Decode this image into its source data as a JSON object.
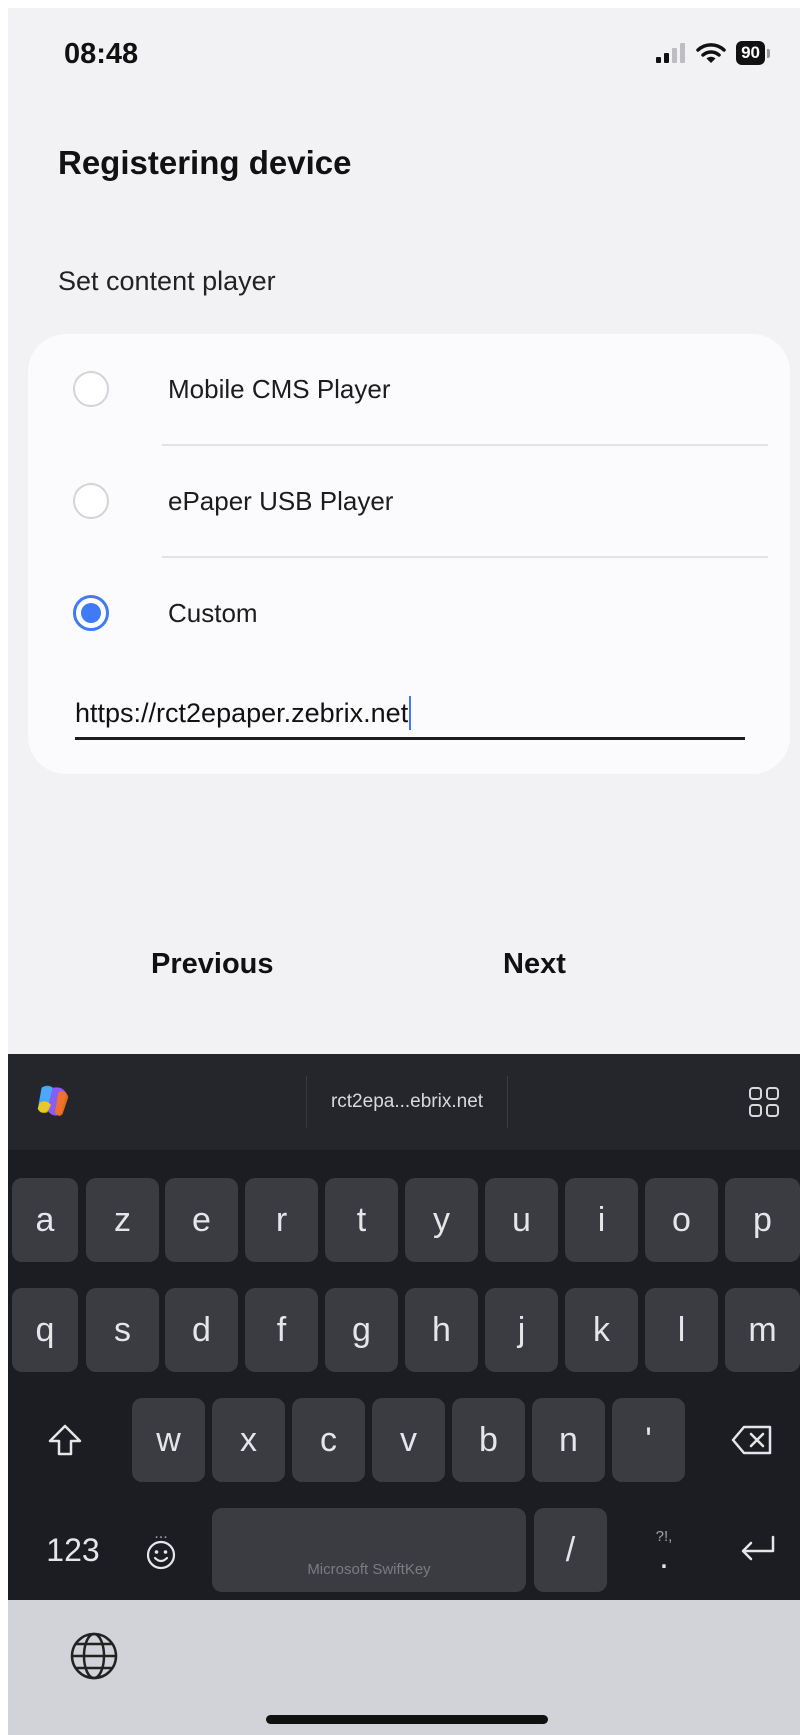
{
  "status": {
    "time": "08:48",
    "battery": "90"
  },
  "page": {
    "title": "Registering device",
    "section_label": "Set content player"
  },
  "options": [
    {
      "label": "Mobile CMS Player",
      "selected": false
    },
    {
      "label": "ePaper USB Player",
      "selected": false
    },
    {
      "label": "Custom",
      "selected": true
    }
  ],
  "custom_url": {
    "value": "https://rct2epaper.zebrix.net"
  },
  "nav": {
    "previous": "Previous",
    "next": "Next"
  },
  "keyboard": {
    "suggestion": "rct2epa...ebrix.net",
    "row1": [
      "a",
      "z",
      "e",
      "r",
      "t",
      "y",
      "u",
      "i",
      "o",
      "p"
    ],
    "row2": [
      "q",
      "s",
      "d",
      "f",
      "g",
      "h",
      "j",
      "k",
      "l",
      "m"
    ],
    "row3": [
      "w",
      "x",
      "c",
      "v",
      "b",
      "n",
      "'"
    ],
    "numbers_key": "123",
    "space_label": "Microsoft SwiftKey",
    "slash_key": "/",
    "punct_hint": "?!,",
    "punct_key": ".",
    "more_hint": "...",
    "accent_color": "#3e7bf5"
  }
}
